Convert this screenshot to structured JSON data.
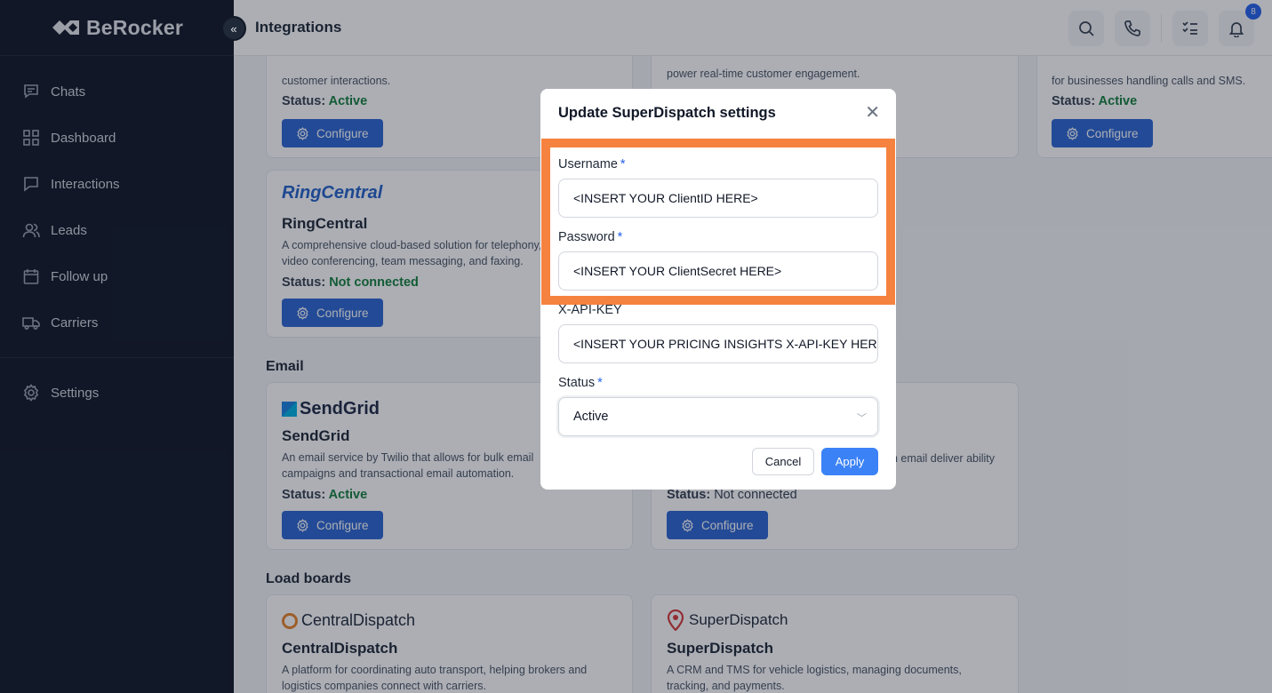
{
  "brand": {
    "name": "BeRocker"
  },
  "header": {
    "title": "Integrations",
    "notification_count": "8"
  },
  "sidebar": {
    "items": [
      {
        "label": "Chats",
        "icon": "chat-icon"
      },
      {
        "label": "Dashboard",
        "icon": "grid-icon"
      },
      {
        "label": "Interactions",
        "icon": "message-icon"
      },
      {
        "label": "Leads",
        "icon": "users-icon"
      },
      {
        "label": "Follow up",
        "icon": "calendar-icon"
      },
      {
        "label": "Carriers",
        "icon": "truck-icon"
      }
    ],
    "settings_label": "Settings"
  },
  "cards": {
    "top_left": {
      "desc": "customer interactions.",
      "status_label": "Status:",
      "status_value": "Active",
      "button": "Configure"
    },
    "top_mid": {
      "desc": "power real-time customer engagement."
    },
    "top_right": {
      "desc": "for businesses handling calls and SMS.",
      "status_label": "Status:",
      "status_value": "Active",
      "button": "Configure"
    },
    "ringcentral": {
      "logo": "RingCentral",
      "title": "RingCentral",
      "desc": "A comprehensive cloud-based solution for telephony, video conferencing, team messaging, and faxing.",
      "status_label": "Status:",
      "status_value": "Not connected",
      "button": "Configure"
    },
    "sendgrid": {
      "logo": "SendGrid",
      "title": "SendGrid",
      "desc": "An email service by Twilio that allows for bulk email campaigns and transactional email automation.",
      "status_label": "Status:",
      "status_value": "Active",
      "button": "Configure"
    },
    "email_right": {
      "desc": "n email deliver ability",
      "status_label": "Status:",
      "status_value": "Not connected",
      "button": "Configure"
    },
    "centraldispatch": {
      "logo": "CentralDispatch",
      "title": "CentralDispatch",
      "desc": "A platform for coordinating auto transport, helping brokers and logistics companies connect with carriers."
    },
    "superdispatch": {
      "logo": "SuperDispatch",
      "title": "SuperDispatch",
      "desc": "A CRM and TMS for vehicle logistics, managing documents, tracking, and payments."
    }
  },
  "sections": {
    "email": "Email",
    "load_boards": "Load boards"
  },
  "modal": {
    "title": "Update SuperDispatch settings",
    "username_label": "Username",
    "username_value": "<INSERT YOUR ClientID HERE>",
    "password_label": "Password",
    "password_value": "<INSERT YOUR ClientSecret HERE>",
    "apikey_label": "X-API-KEY",
    "apikey_value": "<INSERT YOUR PRICING INSIGHTS X-API-KEY HERE>",
    "status_label": "Status",
    "status_value": "Active",
    "required_mark": "*",
    "cancel_label": "Cancel",
    "apply_label": "Apply"
  },
  "colors": {
    "accent": "#2d66d1",
    "highlight": "#f5823f",
    "active": "#15803d",
    "sidebar": "#111827"
  }
}
